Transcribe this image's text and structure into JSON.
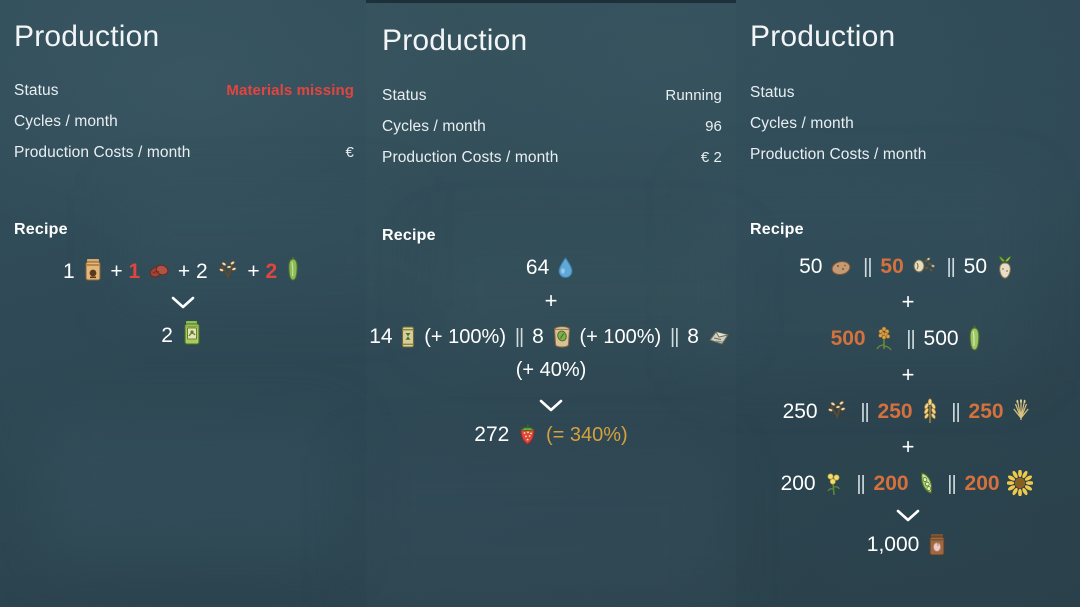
{
  "panels": [
    {
      "title": "Production",
      "stats": [
        {
          "label": "Status",
          "value": "Materials missing",
          "alert": true
        },
        {
          "label": "Cycles / month",
          "value": ""
        },
        {
          "label": "Production Costs / month",
          "value": "€"
        }
      ],
      "recipe_heading": "Recipe",
      "inputs": [
        {
          "qty": "1",
          "color": "white",
          "icon": "jar-preserve-icon",
          "op": "+"
        },
        {
          "qty": "1",
          "color": "red",
          "icon": "beans-red-icon",
          "op": "+"
        },
        {
          "qty": "2",
          "color": "white",
          "icon": "grain-seeds-icon",
          "op": "+"
        },
        {
          "qty": "2",
          "color": "red",
          "icon": "cucumber-icon",
          "op": ""
        }
      ],
      "output": {
        "qty": "2",
        "color": "white",
        "icon": "canned-green-icon"
      }
    },
    {
      "title": "Production",
      "stats": [
        {
          "label": "Status",
          "value": "Running"
        },
        {
          "label": "Cycles / month",
          "value": "96"
        },
        {
          "label": "Production Costs / month",
          "value": "€ 2"
        }
      ],
      "recipe_heading": "Recipe",
      "row_water": {
        "qty": "64",
        "icon": "water-drop-icon"
      },
      "plus": "+",
      "alternatives": [
        {
          "qty": "14",
          "icon": "fertilizer-can-icon",
          "bonus": "(+ 100%)"
        },
        {
          "qty": "8",
          "icon": "compost-bucket-icon",
          "bonus": "(+ 100%)"
        },
        {
          "qty": "8",
          "icon": "soil-bag-icon",
          "bonus": "(+ 40%)"
        }
      ],
      "alt_separator": "||",
      "output": {
        "qty": "272",
        "icon": "strawberry-icon",
        "bonus": "(= 340%)"
      }
    },
    {
      "title": "Production",
      "stats": [
        {
          "label": "Status",
          "value": ""
        },
        {
          "label": "Cycles / month",
          "value": ""
        },
        {
          "label": "Production Costs / month",
          "value": ""
        }
      ],
      "recipe_heading": "Recipe",
      "rows": [
        {
          "items": [
            {
              "qty": "50",
              "color": "white",
              "icon": "potato-icon"
            },
            {
              "qty": "50",
              "color": "orange",
              "icon": "beans-mixed-icon"
            },
            {
              "qty": "50",
              "color": "white",
              "icon": "turnip-icon"
            }
          ]
        },
        {
          "items": [
            {
              "qty": "500",
              "color": "orange",
              "icon": "grain-stalk-icon"
            },
            {
              "qty": "500",
              "color": "white",
              "icon": "cucumber-icon"
            }
          ]
        },
        {
          "items": [
            {
              "qty": "250",
              "color": "white",
              "icon": "grain-seeds-icon"
            },
            {
              "qty": "250",
              "color": "orange",
              "icon": "wheat-icon"
            },
            {
              "qty": "250",
              "color": "orange",
              "icon": "barley-icon"
            }
          ]
        },
        {
          "items": [
            {
              "qty": "200",
              "color": "white",
              "icon": "canola-flower-icon"
            },
            {
              "qty": "200",
              "color": "orange",
              "icon": "pea-pod-icon"
            },
            {
              "qty": "200",
              "color": "orange",
              "icon": "sunflower-icon"
            }
          ]
        }
      ],
      "row_separator": "||",
      "plus": "+",
      "output": {
        "qty": "1,000",
        "color": "white",
        "icon": "seed-bag-icon"
      }
    }
  ],
  "colors": {
    "background": "#2f4853",
    "text": "#e9eff1",
    "alert_red": "#e2453f",
    "accent_orange": "#d4713c",
    "bonus_gold": "#d4a13c"
  }
}
